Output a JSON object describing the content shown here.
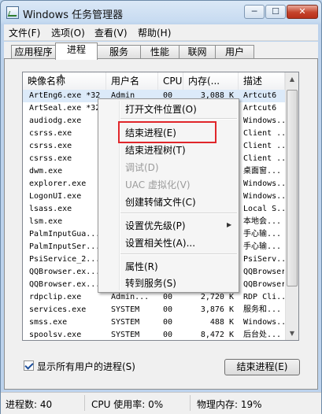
{
  "window": {
    "title": "Windows 任务管理器",
    "minimize": "─",
    "maximize": "☐",
    "close": "✕"
  },
  "menu": [
    "文件(F)",
    "选项(O)",
    "查看(V)",
    "帮助(H)"
  ],
  "tabs": [
    "应用程序",
    "进程",
    "服务",
    "性能",
    "联网",
    "用户"
  ],
  "active_tab": "进程",
  "columns": {
    "name": "映像名称",
    "user": "用户名",
    "cpu": "CPU",
    "mem": "内存(...",
    "desc": "描述"
  },
  "processes": [
    {
      "name": "ArtEng6.exe *32",
      "user": "Admin",
      "cpu": "00",
      "mem": "3,088 K",
      "desc": "Artcut6"
    },
    {
      "name": "ArtSeal.exe *32",
      "user": "",
      "cpu": "",
      "mem": "",
      "desc": "Artcut6"
    },
    {
      "name": "audiodg.exe",
      "user": "",
      "cpu": "",
      "mem": "",
      "desc": "Windows..."
    },
    {
      "name": "csrss.exe",
      "user": "",
      "cpu": "",
      "mem": "",
      "desc": "Client ..."
    },
    {
      "name": "csrss.exe",
      "user": "",
      "cpu": "",
      "mem": "",
      "desc": "Client ..."
    },
    {
      "name": "csrss.exe",
      "user": "",
      "cpu": "",
      "mem": "",
      "desc": "Client ..."
    },
    {
      "name": "dwm.exe",
      "user": "",
      "cpu": "",
      "mem": "",
      "desc": "桌面窗..."
    },
    {
      "name": "explorer.exe",
      "user": "",
      "cpu": "",
      "mem": "",
      "desc": "Windows..."
    },
    {
      "name": "LogonUI.exe",
      "user": "",
      "cpu": "",
      "mem": "",
      "desc": "Windows..."
    },
    {
      "name": "lsass.exe",
      "user": "",
      "cpu": "",
      "mem": "",
      "desc": "Local S..."
    },
    {
      "name": "lsm.exe",
      "user": "",
      "cpu": "",
      "mem": "",
      "desc": "本地会..."
    },
    {
      "name": "PalmInputGua...",
      "user": "",
      "cpu": "",
      "mem": "",
      "desc": "手心输..."
    },
    {
      "name": "PalmInputSer...",
      "user": "",
      "cpu": "",
      "mem": "",
      "desc": "手心输..."
    },
    {
      "name": "PsiService_2...",
      "user": "",
      "cpu": "",
      "mem": "",
      "desc": "PsiServ..."
    },
    {
      "name": "QQBrowser.ex...",
      "user": "",
      "cpu": "",
      "mem": "",
      "desc": "QQBrowser"
    },
    {
      "name": "QQBrowser.ex...",
      "user": "",
      "cpu": "",
      "mem": "",
      "desc": "QQBrowser"
    },
    {
      "name": "rdpclip.exe",
      "user": "Admin...",
      "cpu": "00",
      "mem": "2,720 K",
      "desc": "RDP Cli..."
    },
    {
      "name": "services.exe",
      "user": "SYSTEM",
      "cpu": "00",
      "mem": "3,876 K",
      "desc": "服务和..."
    },
    {
      "name": "smss.exe",
      "user": "SYSTEM",
      "cpu": "00",
      "mem": "488 K",
      "desc": "Windows..."
    },
    {
      "name": "spoolsv.exe",
      "user": "SYSTEM",
      "cpu": "00",
      "mem": "8,472 K",
      "desc": "后台处..."
    }
  ],
  "context_menu": {
    "open_location": "打开文件位置(O)",
    "end_process": "结束进程(E)",
    "end_tree": "结束进程树(T)",
    "debug": "调试(D)",
    "uac": "UAC 虚拟化(V)",
    "dump": "创建转储文件(C)",
    "priority": "设置优先级(P)",
    "affinity": "设置相关性(A)...",
    "properties": "属性(R)",
    "goto_service": "转到服务(S)"
  },
  "show_all_users": {
    "label": "显示所有用户的进程(S)",
    "checked": true
  },
  "end_process_button": "结束进程(E)",
  "status": {
    "processes": "进程数: 40",
    "cpu": "CPU 使用率: 0%",
    "memory": "物理内存: 19%"
  }
}
